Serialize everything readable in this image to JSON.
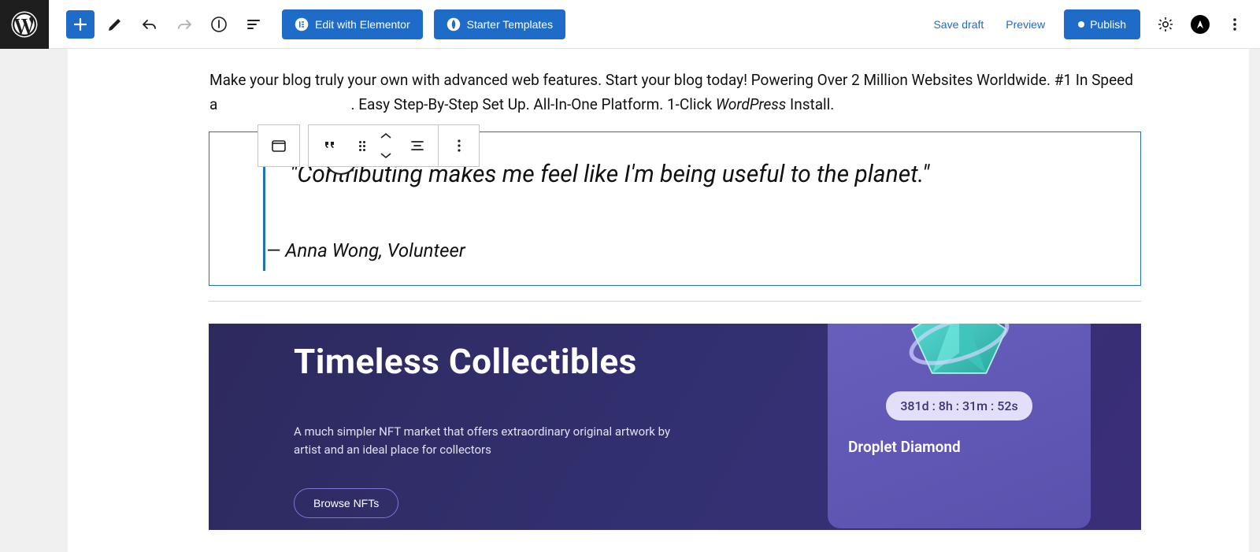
{
  "toolbar": {
    "edit_elementor": "Edit with Elementor",
    "starter_templates": "Starter Templates",
    "save_draft": "Save draft",
    "preview": "Preview",
    "publish": "Publish"
  },
  "content": {
    "paragraph_a": "Make your blog truly your own with advanced web features. Start your blog today! Powering Over 2 Million Websites Worldwide. #1 In Speed a",
    "paragraph_b": ". Easy Step-By-Step Set Up. All-In-One Platform. 1-Click ",
    "paragraph_italic": "WordPress",
    "paragraph_c": " Install."
  },
  "quote": {
    "text": "\"Contributing makes me feel like I'm being useful to the planet.\"",
    "cite_prefix": "— ",
    "cite": "Anna Wong, Volunteer"
  },
  "banner": {
    "title": "Timeless Collectibles",
    "desc": "A much simpler NFT market that offers extraordinary original artwork by artist and an ideal place for collectors",
    "button": "Browse NFTs",
    "card_timer": "381d  :   8h   :   31m  :   52s",
    "card_title": "Droplet Diamond"
  }
}
